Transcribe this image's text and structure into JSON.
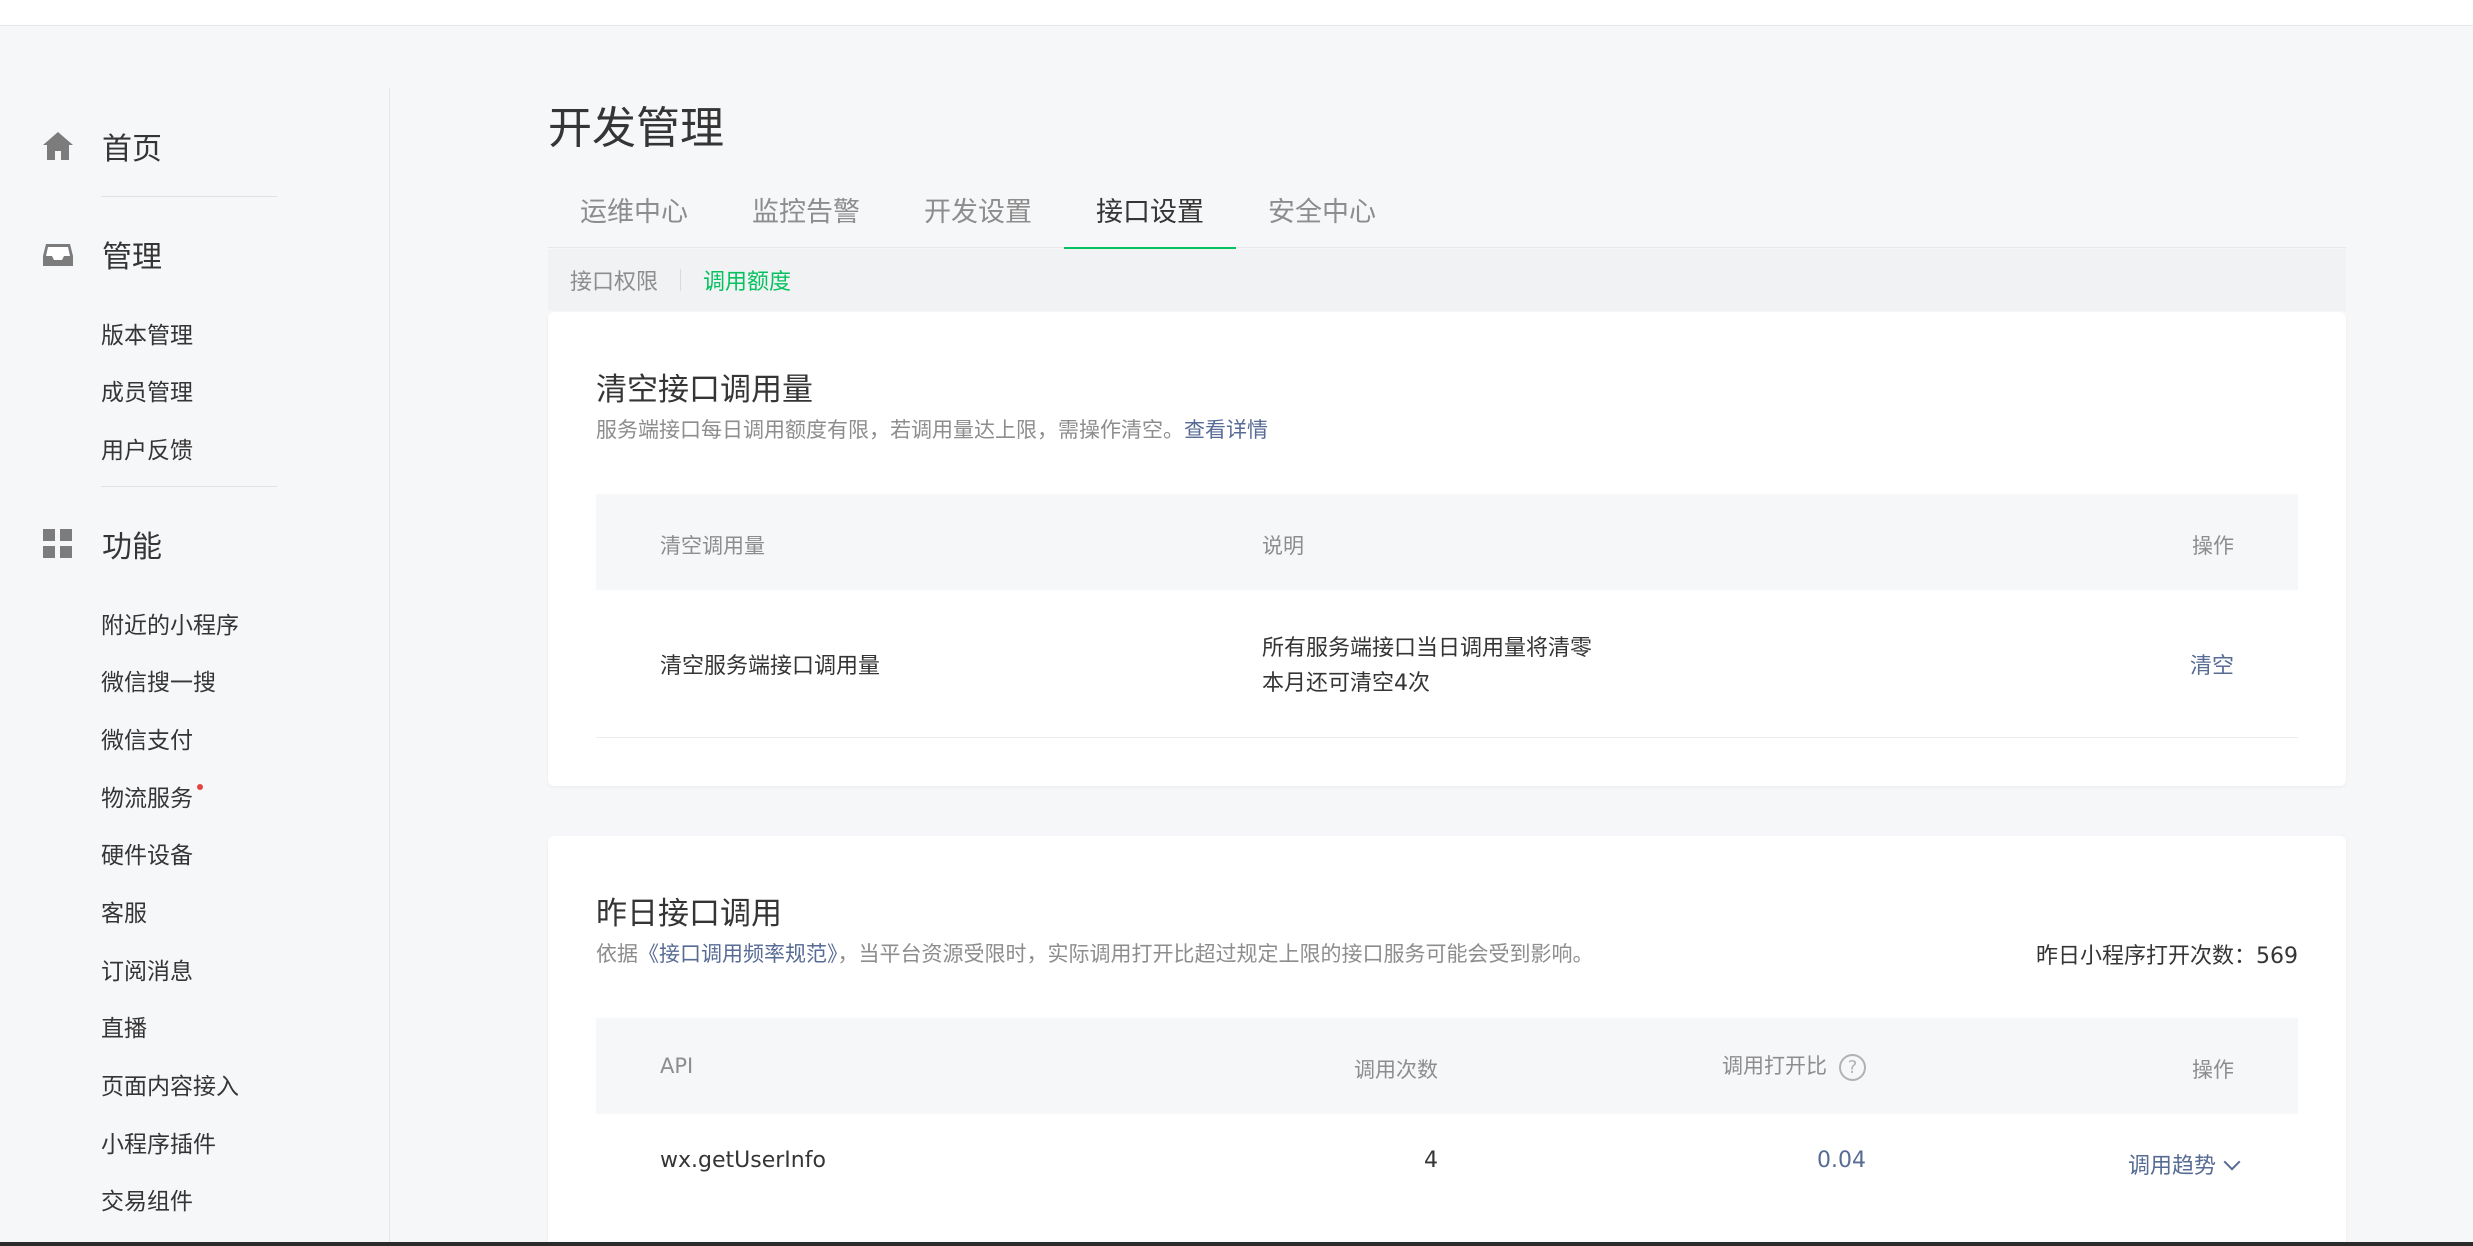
{
  "sidebar": {
    "home": "首页",
    "manage": {
      "label": "管理",
      "items": [
        "版本管理",
        "成员管理",
        "用户反馈"
      ]
    },
    "features": {
      "label": "功能",
      "items": [
        "附近的小程序",
        "微信搜一搜",
        "微信支付",
        "物流服务",
        "硬件设备",
        "客服",
        "订阅消息",
        "直播",
        "页面内容接入",
        "小程序插件",
        "交易组件"
      ]
    }
  },
  "page": {
    "title": "开发管理",
    "tabs": [
      "运维中心",
      "监控告警",
      "开发设置",
      "接口设置",
      "安全中心"
    ],
    "active_tab": "接口设置",
    "subtabs": [
      "接口权限",
      "调用额度"
    ],
    "active_subtab": "调用额度"
  },
  "clear_card": {
    "title": "清空接口调用量",
    "desc": "服务端接口每日调用额度有限，若调用量达上限，需操作清空。",
    "desc_link": "查看详情",
    "headers": [
      "清空调用量",
      "说明",
      "操作"
    ],
    "row": {
      "name": "清空服务端接口调用量",
      "desc_line1": "所有服务端接口当日调用量将清零",
      "desc_line2": "本月还可清空4次",
      "action": "清空"
    }
  },
  "yesterday_card": {
    "title": "昨日接口调用",
    "desc_prefix": "依据",
    "desc_link": "《接口调用频率规范》",
    "desc_suffix": "，当平台资源受限时，实际调用打开比超过规定上限的接口服务可能会受到影响。",
    "opens_label": "昨日小程序打开次数：",
    "opens_value": "569",
    "headers": [
      "API",
      "调用次数",
      "调用打开比",
      "操作"
    ],
    "help_glyph": "?",
    "rows": [
      {
        "api": "wx.getUserInfo",
        "calls": "4",
        "ratio": "0.04",
        "action": "调用趋势"
      }
    ]
  },
  "colors": {
    "accent": "#07c160",
    "link": "#576b95",
    "dot": "#e64340"
  }
}
